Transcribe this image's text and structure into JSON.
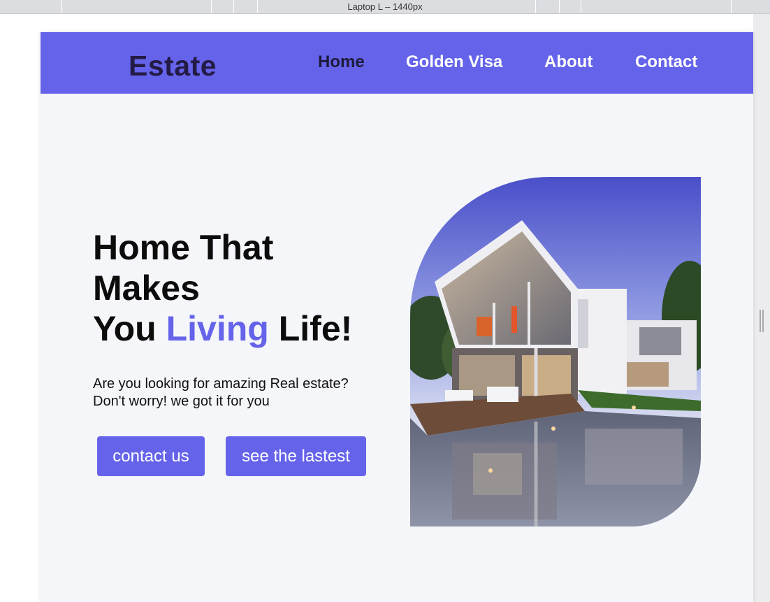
{
  "devtools": {
    "ruler_label": "Laptop L – 1440px"
  },
  "site": {
    "logo": "Estate",
    "nav": [
      {
        "label": "Home",
        "active": true
      },
      {
        "label": "Golden Visa",
        "active": false
      },
      {
        "label": "About",
        "active": false
      },
      {
        "label": "Contact",
        "active": false
      }
    ]
  },
  "hero": {
    "headline_line1": "Home That",
    "headline_line2": "Makes",
    "headline_line3_prefix": "You ",
    "headline_accent": "Living",
    "headline_line3_suffix": " Life!",
    "subtext_line1": "Are you looking for amazing Real estate?",
    "subtext_line2": "Don't worry! we got it for you",
    "primary_button": "contact us",
    "secondary_button": "see the lastest"
  },
  "colors": {
    "brand": "#6563ea",
    "logo": "#231b45",
    "active_nav": "#1d1a3a",
    "background": "#f5f6f9"
  }
}
